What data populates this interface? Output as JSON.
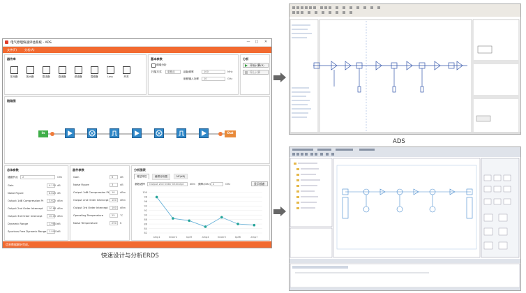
{
  "left_app": {
    "title": "电气原理快速评估系统 - ADS",
    "window_buttons": [
      "—",
      "□",
      "✕"
    ],
    "menu": [
      "文件(F)",
      "分析(A)"
    ],
    "device_library": {
      "title": "器件库",
      "devices": [
        "压光器",
        "放大器",
        "乘法器",
        "衰减器",
        "滤波器",
        "混频器",
        "Loss",
        "开关"
      ]
    },
    "basic_params": {
      "title": "基本参数",
      "checkbox_label": "频域分析",
      "scan_mode_label": "扫描方式",
      "scan_mode_value": "单频点",
      "freq_label": "起始频率",
      "freq_value": "100",
      "freq_unit": "MHz",
      "power_label": "射频输入功率",
      "power_value": "10",
      "power_unit": "GHz"
    },
    "analysis": {
      "title": "分析",
      "run_button": "开始计算(R)",
      "stop_button": "停止计算"
    },
    "chain": {
      "title": "链路图",
      "in_label": "In",
      "out_label": "Out"
    },
    "output_params": {
      "title": "总体参数",
      "select_label": "链路节点",
      "select_value": "2",
      "select_unit": "GHz",
      "rows": [
        {
          "label": "Gain",
          "value": "4.155",
          "unit": "dB"
        },
        {
          "label": "Noise Figure",
          "value": "8.825",
          "unit": "dB"
        },
        {
          "label": "Output 1dB Compression Pt",
          "value": "3.622",
          "unit": "dBm"
        },
        {
          "label": "Output 2nd Order Intercept",
          "value": "10.88",
          "unit": "dBm"
        },
        {
          "label": "Output 3rd Order Intercept",
          "value": "10.05",
          "unit": "dBm"
        },
        {
          "label": "Dynamic Range",
          "value": "1.9800",
          "unit": "dB"
        },
        {
          "label": "Spurious Free Dynamic Range",
          "value": "1.0000",
          "unit": "dB"
        }
      ]
    },
    "device_params": {
      "title": "器件参数",
      "rows": [
        {
          "label": "Gain",
          "value": "6",
          "unit": "dB"
        },
        {
          "label": "Noise Figure",
          "value": "3",
          "unit": "dB"
        },
        {
          "label": "Output 1dB Compression Pt",
          "value": "10",
          "unit": "dBm"
        },
        {
          "label": "Output 2nd Order Intercept",
          "value": "100",
          "unit": "dBm"
        },
        {
          "label": "Output 3rd Order Intercept",
          "value": "100",
          "unit": "dBm"
        },
        {
          "label": "Operating Temperature",
          "value": "25",
          "unit": "°C"
        },
        {
          "label": "Noise Temperature",
          "value": "290",
          "unit": "K"
        }
      ]
    },
    "result_chart": {
      "title": "分析图表",
      "tabs": [
        "增益特性",
        "级联分析图",
        "NF(dB)"
      ],
      "param_label": "参数选择",
      "param_value": "Output 2nd Order Intercept",
      "unit1": "dBm",
      "freq_label": "频率(GHz)",
      "freq_value": "2",
      "freq_unit": "GHz",
      "button": "显示频谱"
    },
    "status": "信息数据解析完成。"
  },
  "chart_data": {
    "type": "line",
    "categories": [
      "amp1",
      "mixer2",
      "bpf3",
      "amp4",
      "mixer5",
      "bpf6",
      "amp7"
    ],
    "series": [
      {
        "values": [
          98,
          88.5,
          87.5,
          84.8,
          89,
          86,
          85.5
        ]
      }
    ],
    "ylabel": "",
    "ylim": [
      82,
      100
    ],
    "yticks": [
      100,
      98,
      96,
      94,
      92,
      90,
      88,
      86,
      84,
      82
    ],
    "grid": true,
    "line_color": "#6ab3d9",
    "marker_color": "#27a59a"
  },
  "captions": {
    "left": "快速设计与分析ERDS",
    "top_right": "ADS"
  },
  "colors": {
    "accent": "#f26a30",
    "chain_device": "#2f87c7",
    "in_block": "#3fae49",
    "out_block": "#e88a3a"
  }
}
